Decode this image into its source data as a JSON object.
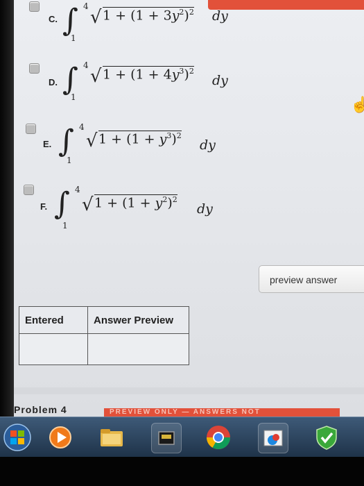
{
  "options": [
    {
      "label": "C.",
      "lower": "1",
      "upper": "4",
      "radicand_pre": "1 + (1 + 3",
      "var": "y",
      "inner_exp": "2",
      "outer_exp": "2",
      "dy": "dy"
    },
    {
      "label": "D.",
      "lower": "1",
      "upper": "4",
      "radicand_pre": "1 + (1 + 4",
      "var": "y",
      "inner_exp": "3",
      "outer_exp": "2",
      "dy": "dy"
    },
    {
      "label": "E.",
      "lower": "1",
      "upper": "4",
      "radicand_pre": "1 + (1 + ",
      "var": "y",
      "inner_exp": "3",
      "outer_exp": "2",
      "dy": "dy"
    },
    {
      "label": "F.",
      "lower": "1",
      "upper": "4",
      "radicand_pre": "1 + (1 + ",
      "var": "y",
      "inner_exp": "2",
      "outer_exp": "2",
      "dy": "dy"
    }
  ],
  "preview_button": {
    "label": "preview answer"
  },
  "answer_table": {
    "headers": [
      "Entered",
      "Answer Preview"
    ]
  },
  "problem": {
    "label": "Problem 4"
  },
  "banner": {
    "text": "PREVIEW ONLY — ANSWERS NOT"
  },
  "icons": {
    "integral": "integral-sign",
    "sqrt": "square-root-sign",
    "cursor": "hand-pointer-icon",
    "taskbar": [
      "windows-start-icon",
      "media-player-icon",
      "file-explorer-icon",
      "network-icon",
      "chrome-icon",
      "paint-icon",
      "security-shield-icon"
    ]
  },
  "colors": {
    "banner": "#e2513a",
    "taskbar": "#2a4360"
  }
}
